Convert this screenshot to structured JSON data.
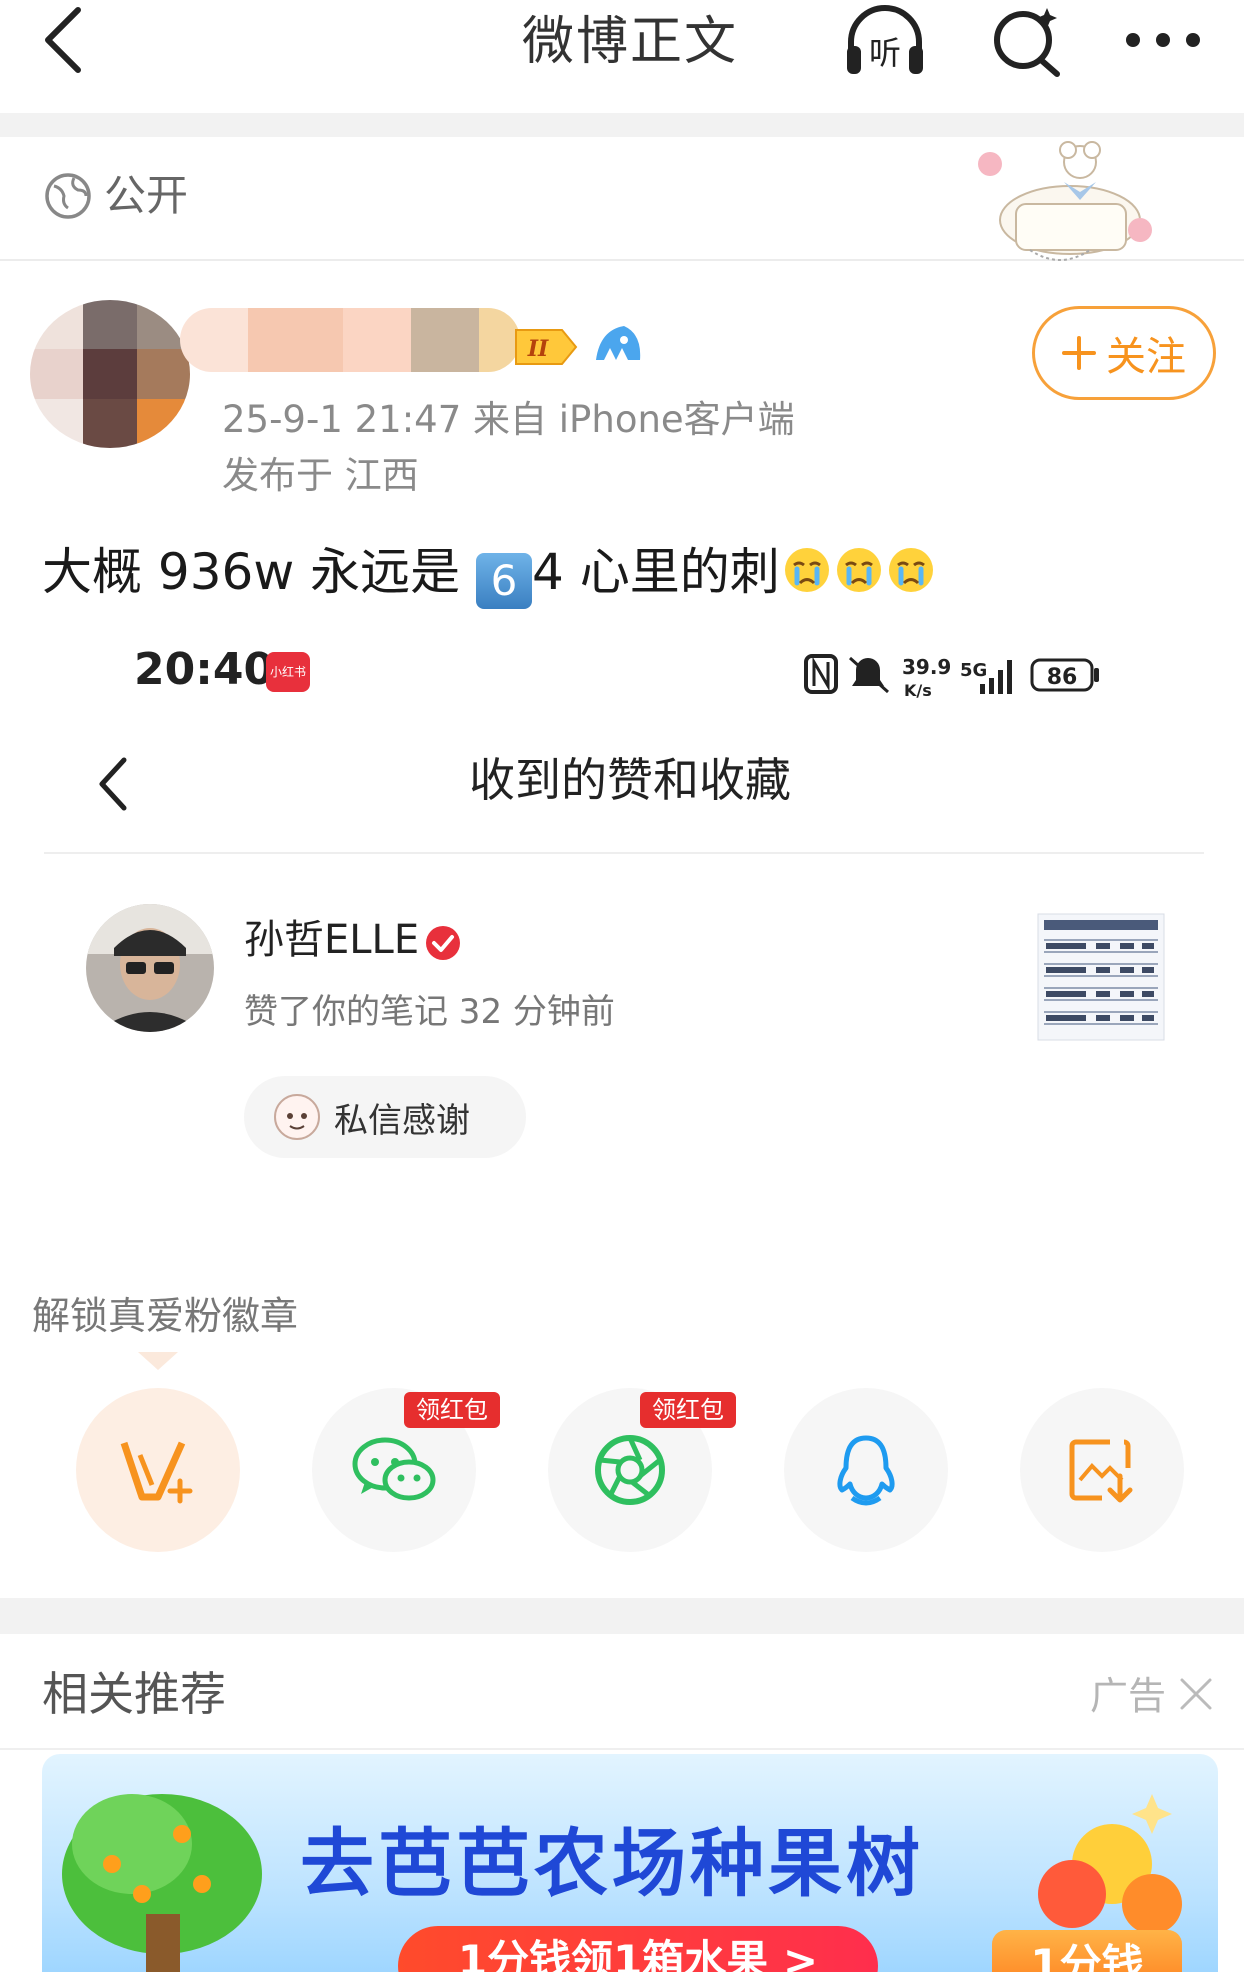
{
  "nav": {
    "title": "微博正文",
    "listen_label": "听"
  },
  "post": {
    "visibility": "公开",
    "follow_label": "关注",
    "meta": "25-9-1 21:47   来自 iPhone客户端",
    "location": "发布于 江西",
    "text_before": "大概 936w 永远是 ",
    "keycap": "6",
    "text_after": "4 心里的刺"
  },
  "embedded": {
    "status_time": "20:40",
    "app_badge": "小红书",
    "status_right": {
      "speed": "39.9",
      "speed_unit": "K/s",
      "network": "5G",
      "battery": "86"
    },
    "title": "收到的赞和收藏",
    "notification": {
      "user": "孙哲ELLE",
      "action": "赞了你的笔记   32 分钟前",
      "thanks_label": "私信感谢"
    }
  },
  "fan_badge": {
    "label": "解锁真爱粉徽章"
  },
  "share": {
    "hongbao_tag": "领红包"
  },
  "recommend": {
    "title": "相关推荐",
    "ad_label": "广告"
  },
  "ad": {
    "headline": "去芭芭农场种果树",
    "cta": "1分钱领1箱水果 >",
    "price": "1分钱"
  },
  "colors": {
    "accent_orange": "#f7931e",
    "verified_red": "#e8303c",
    "wechat_green": "#2fbf5f",
    "qq_blue": "#1e9bf0",
    "ad_blue": "#1f48d6"
  }
}
